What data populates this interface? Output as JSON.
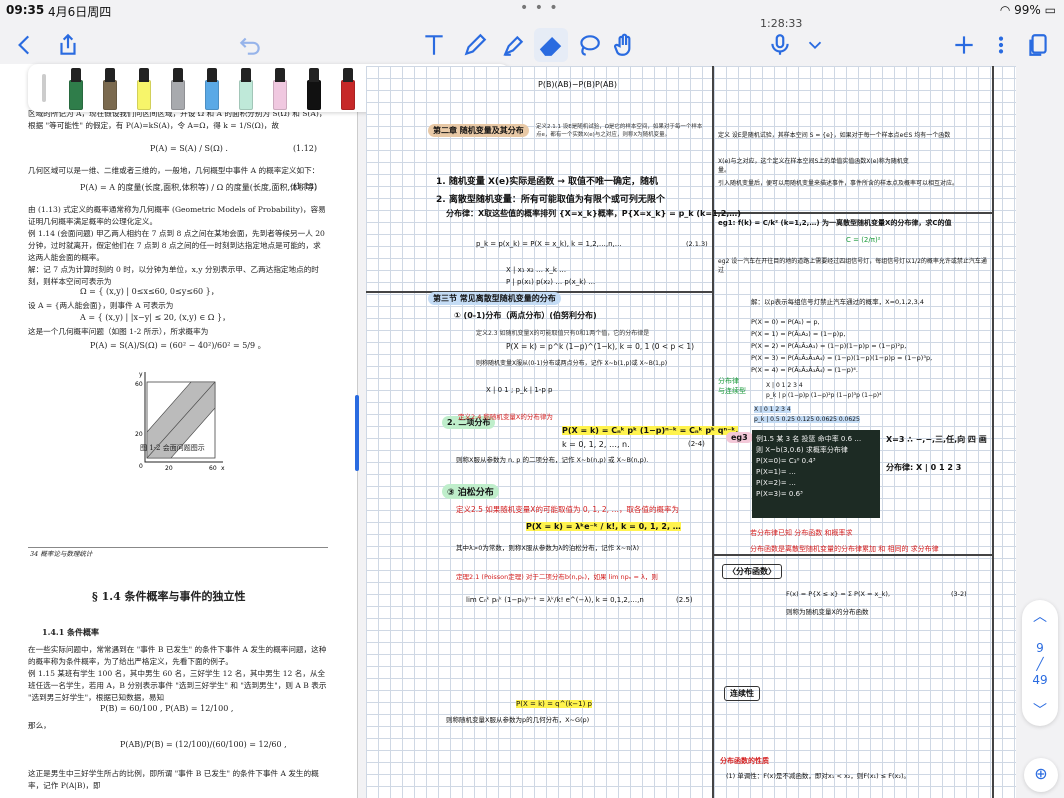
{
  "status": {
    "time": "09:35",
    "date": "4月6日周四",
    "battery": "99%",
    "timer": "1:28:33"
  },
  "pens": [
    "#2f7d4a",
    "#7b6a4f",
    "#f7f56a",
    "#a8aaae",
    "#5aa9e6",
    "#bfe9d9",
    "#f0c8e0",
    "#111111",
    "#c62828",
    "#e08a1e",
    "#2e3a9f",
    "#2f7d4a"
  ],
  "left": {
    "p1": "区域的所记为 A，现在假设我们向区间区域，并设 Ω 和 A 的面积分别为 S(Ω) 和 S(A)，根据 \"等可能性\" 的假定，有 P(A)=kS(A)，令 A=Ω，得 k = 1/S(Ω)，故",
    "eq1": "P(A) = S(A) / S(Ω) .",
    "eq1n": "(1.12)",
    "p2": "几何区域可以是一维、二维或者三维的，一般地，几何概型中事件 A 的概率定义如下：",
    "eq2": "P(A) = A 的度量(长度,面积,体积等) / Ω 的度量(长度,面积,体积等)",
    "eq2n": "(1.13)",
    "p3": "由 (1.13) 式定义的概率通常称为几何概率 (Geometric Models of Probability)，容易证明几何概率满足概率的公理化定义。",
    "p4": "例 1.14 (会面问题)  甲乙两人相约在 7 点到 8 点之间在某地会面，先到者等候另一人 20 分钟，过时就离开，假定他们在 7 点到 8 点之间的任一时刻到达指定地点是可能的，求这两人能会面的概率。",
    "p5": "解：记 7 点为计算时刻的 0 时，以分钟为单位，x,y 分别表示甲、乙两达指定地点的时刻，则样本空间可表示为",
    "eq3": "Ω = { (x,y) | 0≤x≤60, 0≤y≤60 }，",
    "p6": "设 A = {两人能会面}，则事件 A 可表示为",
    "eq4": "A = { (x,y) | |x−y| ≤ 20, (x,y) ∈ Ω }，",
    "p7": "这是一个几何概率问题（如图 1-2 所示），所求概率为",
    "eq5": "P(A) = S(A)/S(Ω) = (60² − 40²)/60² = 5/9 。",
    "figcap": "图 1-2  会面问题图示",
    "footer": "34   概率论与数理统计",
    "section": "§ 1.4   条件概率与事件的独立性",
    "sub": "1.4.1   条件概率",
    "p8": "在一些实际问题中，常常遇到在 \"事件 B 已发生\" 的条件下事件 A 发生的概率问题，这种的概率称为条件概率，为了给出严格定义，先看下面的例子。",
    "p9": "例 1.15  某班有学生 100 名，其中男生 60 名，三好学生 12 名，其中男生 12 名，从全班任选一名学生，若用 A，B 分别表示事件 \"选到三好学生\" 和 \"选到男生\"，则 A B 表示 \"选到男三好学生\"，根据已知数据，易知",
    "eq6": "P(B) = 60/100 ,  P(AB) = 12/100 ,",
    "p10": "那么，",
    "eq7": "P(AB)/P(B) = (12/100)/(60/100) = 12/60 ,",
    "p11": "这正是男生中三好学生所占的比例，即所谓 \"事件 B 已发生\" 的条件下事件 A 发生的概率，记作 P(A|B)，即",
    "figx": "x",
    "figy": "y",
    "fig60x": "60",
    "fig60y": "60",
    "fig20x": "20",
    "fig20y": "20",
    "fig0": "0"
  },
  "right": {
    "top_line": "P(B)(AB)−P(B)P(AB)",
    "ch3": "第二章 随机变量及其分布",
    "def21": "定义2.1.1 设E是随机试验，Ω是它的样本空间，如果对于每一个样本点e，都有一个实数X(e)与之对应，则称X为随机变量。",
    "item1": "1. 随机变量 X(e)实际是函数 → 取值不唯一确定，随机",
    "item2": "2. 离散型随机变量：所有可能取值为有限个或可列无限个",
    "dist": "分布律：X取这些值的概率排列 {X=x_k}概率，P{X=x_k} = p_k  (k=1,2,…)",
    "pk": "p_k = p(x_k) = P(X = x_k), k = 1,2,…,n,…",
    "pkn": "(2.1.3)",
    "table_header": "X | x₁  x₂  …  x_k  …",
    "table_row": "P | p(x₁)  p(x₂)  …  p(x_k)  …",
    "sec2": "第三节 常见离散型随机变量的分布",
    "sub1": "① (0-1)分布（两点分布）(伯努利分布)",
    "def23": "定义2.3 如随机变量X的可能取值只有0和1两个值，它的分布律是",
    "eq01": "P(X = k) = p^k (1−p)^(1−k),  k = 0, 1 (0 < p < 1)",
    "note01": "则称随机变量X服从(0-1)分布或两点分布，记作 X~b(1,p)或 X~B(1,p)",
    "table01": "X | 0  1 ;  p_k | 1-p  p",
    "sub2": "2. 二项分布",
    "def24": "定义2.4 称随机变量X的分布律为",
    "eqbin": "P(X = k) = Cₙᵏ pᵏ (1−p)ⁿ⁻ᵏ = Cₙᵏ pᵏ qⁿ⁻ᵏ,",
    "eqbin2": "k = 0, 1, 2, …, n.",
    "eqbinn": "(2-4)",
    "binnote": "则称X服从参数为 n, p 的二项分布，记作 X~b(n,p) 或 X~B(n,p).",
    "sub3": "③ 泊松分布",
    "def25": "定义2.5 如果随机变量X的可能取值为 0, 1, 2, …，取各值的概率为",
    "eqpois": "P(X = k) = λᵏe⁻ᵏ / k!,  k = 0, 1, 2, …",
    "poisnote": "其中λ>0为常数，则称X服从参数为λ的泊松分布，记作 X~π(λ)",
    "thm21": "定理2.1 (Poisson定理) 对于二项分布b(n,pₙ)，如果 lim npₙ = λ，则",
    "eqlim": "lim Cₙᵏ pₙᵏ (1−pₙ)ⁿ⁻ᵏ = λᵏ/k! e^(−λ),   k = 0,1,2,…,n",
    "eqlimn": "(2.5)",
    "geom": "P(X = k) = q^(k−1) p",
    "geomnote": "则称随机变量X服从参数为p的几何分布，X~G(p)",
    "r_def": "定义 设E是随机试验，其样本空间 S = {e}，如果对于每一个样本点e∈S 均有一个函数",
    "r_x": "X(e)与之对应，这个定义在样本空间S上的单值实值函数X(e)称为随机变量。",
    "r_intro": "引入随机变量后，便可以用随机变量来描述事件，事件所含的样本点及概率可以相互对应。",
    "r_eg1": "eg1: f(k) = C/k²  (k=1,2,…) 为一离散型随机变量X的分布律，求C的值",
    "r_eg2": "eg2  设一汽车在开往目的地的道路上需要经过四组信号灯，每组信号灯以1/2的概率允许或禁止汽车通过",
    "r_sol": "解：以p表示每组信号灯禁止汽车通过的概率，X=0,1,2,3,4",
    "r_px0": "P(X = 0) = P(A₁) = p,",
    "r_px1": "P(X = 1) = P(Ā₁A₂) = (1−p)p,",
    "r_px2": "P(X = 2) = P(Ā₁Ā₂A₃) = (1−p)(1−p)p = (1−p)²p,",
    "r_px3": "P(X = 3) = P(Ā₁Ā₂Ā₃A₄) = (1−p)(1−p)(1−p)p = (1−p)³p,",
    "r_px4": "P(X = 4) = P(Ā₁Ā₂Ā₃Ā₄) = (1−p)⁴.",
    "r_tab1": "X | 0   1   2   3   4",
    "r_tab2": "p_k | p   (1−p)p   (1−p)²p   (1−p)³p   (1−p)⁴",
    "r_tab3": "X | 0   1   2   3   4",
    "r_tab4": "p_k | 0.5   0.25   0.125   0.0625   0.0625",
    "r_eg3": "eg3",
    "chalk": "例1.5 某 3 名 投篮 命中率 0.6 …\n则 X~b(3,0.6) 求概率分布律\nP(X=0)= C₃⁰ 0.4³\nP(X=1)= …\nP(X=2)= …\nP(X=3)= 0.6³",
    "r_sumline": "X=3  ∴ −,−,三,任,向 四 画",
    "r_dist": "分布律: X | 0  1  2  3",
    "r_red1": "若分布律已知 分布函数 和概率求",
    "r_red2": "分布函数是离散型随机变量的分布律累加 和 相同的 求分布律",
    "r_fdef": "〈分布函数〉",
    "r_fx": "F(x) = P{X ≤ x} = Σ P(X = x_k),",
    "r_fxn": "(3-2)",
    "r_fnote": "则称为随机变量X的分布函数",
    "r_cont": "连续性",
    "r_prop": "分布函数的性质",
    "r_p1": "(1) 单调性：F(x)是不减函数，即对x₁ < x₂，则F(x₁) ≤ F(x₂)。",
    "pencil_green": "分布律\n与连续型",
    "r_ans": "C = (2/π)²"
  },
  "nav": {
    "page": "9",
    "total": "49"
  }
}
